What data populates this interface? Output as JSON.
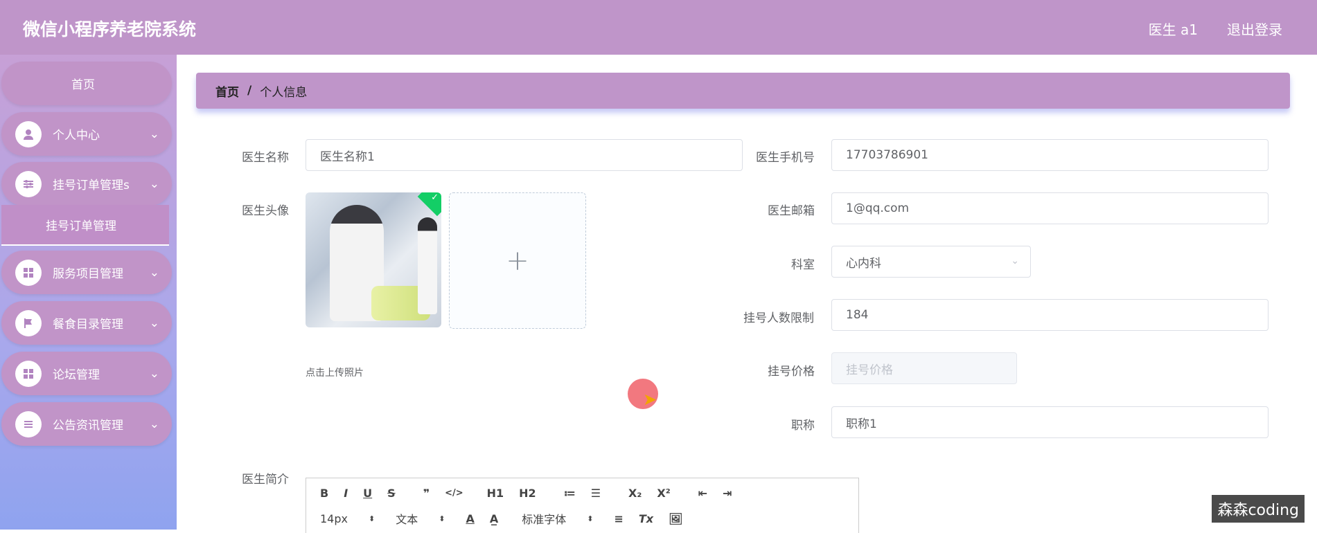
{
  "header": {
    "title": "微信小程序养老院系统",
    "user": "医生 a1",
    "logout": "退出登录"
  },
  "sidebar": {
    "items": [
      {
        "label": "首页",
        "icon": ""
      },
      {
        "label": "个人中心",
        "icon": "user-icon"
      },
      {
        "label": "挂号订单管理s",
        "icon": "sliders-icon"
      },
      {
        "label": "服务项目管理",
        "icon": "grid-icon"
      },
      {
        "label": "餐食目录管理",
        "icon": "flag-icon"
      },
      {
        "label": "论坛管理",
        "icon": "grid-icon"
      },
      {
        "label": "公告资讯管理",
        "icon": "list-icon"
      }
    ],
    "sub_item": "挂号订单管理"
  },
  "breadcrumb": {
    "home": "首页",
    "separator": "/",
    "current": "个人信息"
  },
  "form": {
    "name_label": "医生名称",
    "name_value": "医生名称1",
    "phone_label": "医生手机号",
    "phone_value": "17703786901",
    "avatar_label": "医生头像",
    "upload_plus": "+",
    "upload_tip": "点击上传照片",
    "email_label": "医生邮箱",
    "email_value": "1@qq.com",
    "dept_label": "科室",
    "dept_value": "心内科",
    "limit_label": "挂号人数限制",
    "limit_value": "184",
    "price_label": "挂号价格",
    "price_placeholder": "挂号价格",
    "title_label": "职称",
    "title_value": "职称1",
    "intro_label": "医生简介"
  },
  "editor": {
    "row1": [
      "B",
      "I",
      "U",
      "S",
      "❞",
      "</>",
      "H1",
      "H2",
      "≔",
      "☰",
      "X₂",
      "X²",
      "⇤",
      "⇥"
    ],
    "size": "14px",
    "text": "文本",
    "font": "标准字体",
    "row2_icons": [
      "A",
      "A̲",
      "≡",
      "Tx",
      "🖼"
    ]
  },
  "watermark": "森森coding",
  "colors": {
    "header": "#bf95c9",
    "sidebar_top": "#c7a0d6",
    "sidebar_bottom": "#8fa3ef",
    "accent": "#13ce66"
  }
}
